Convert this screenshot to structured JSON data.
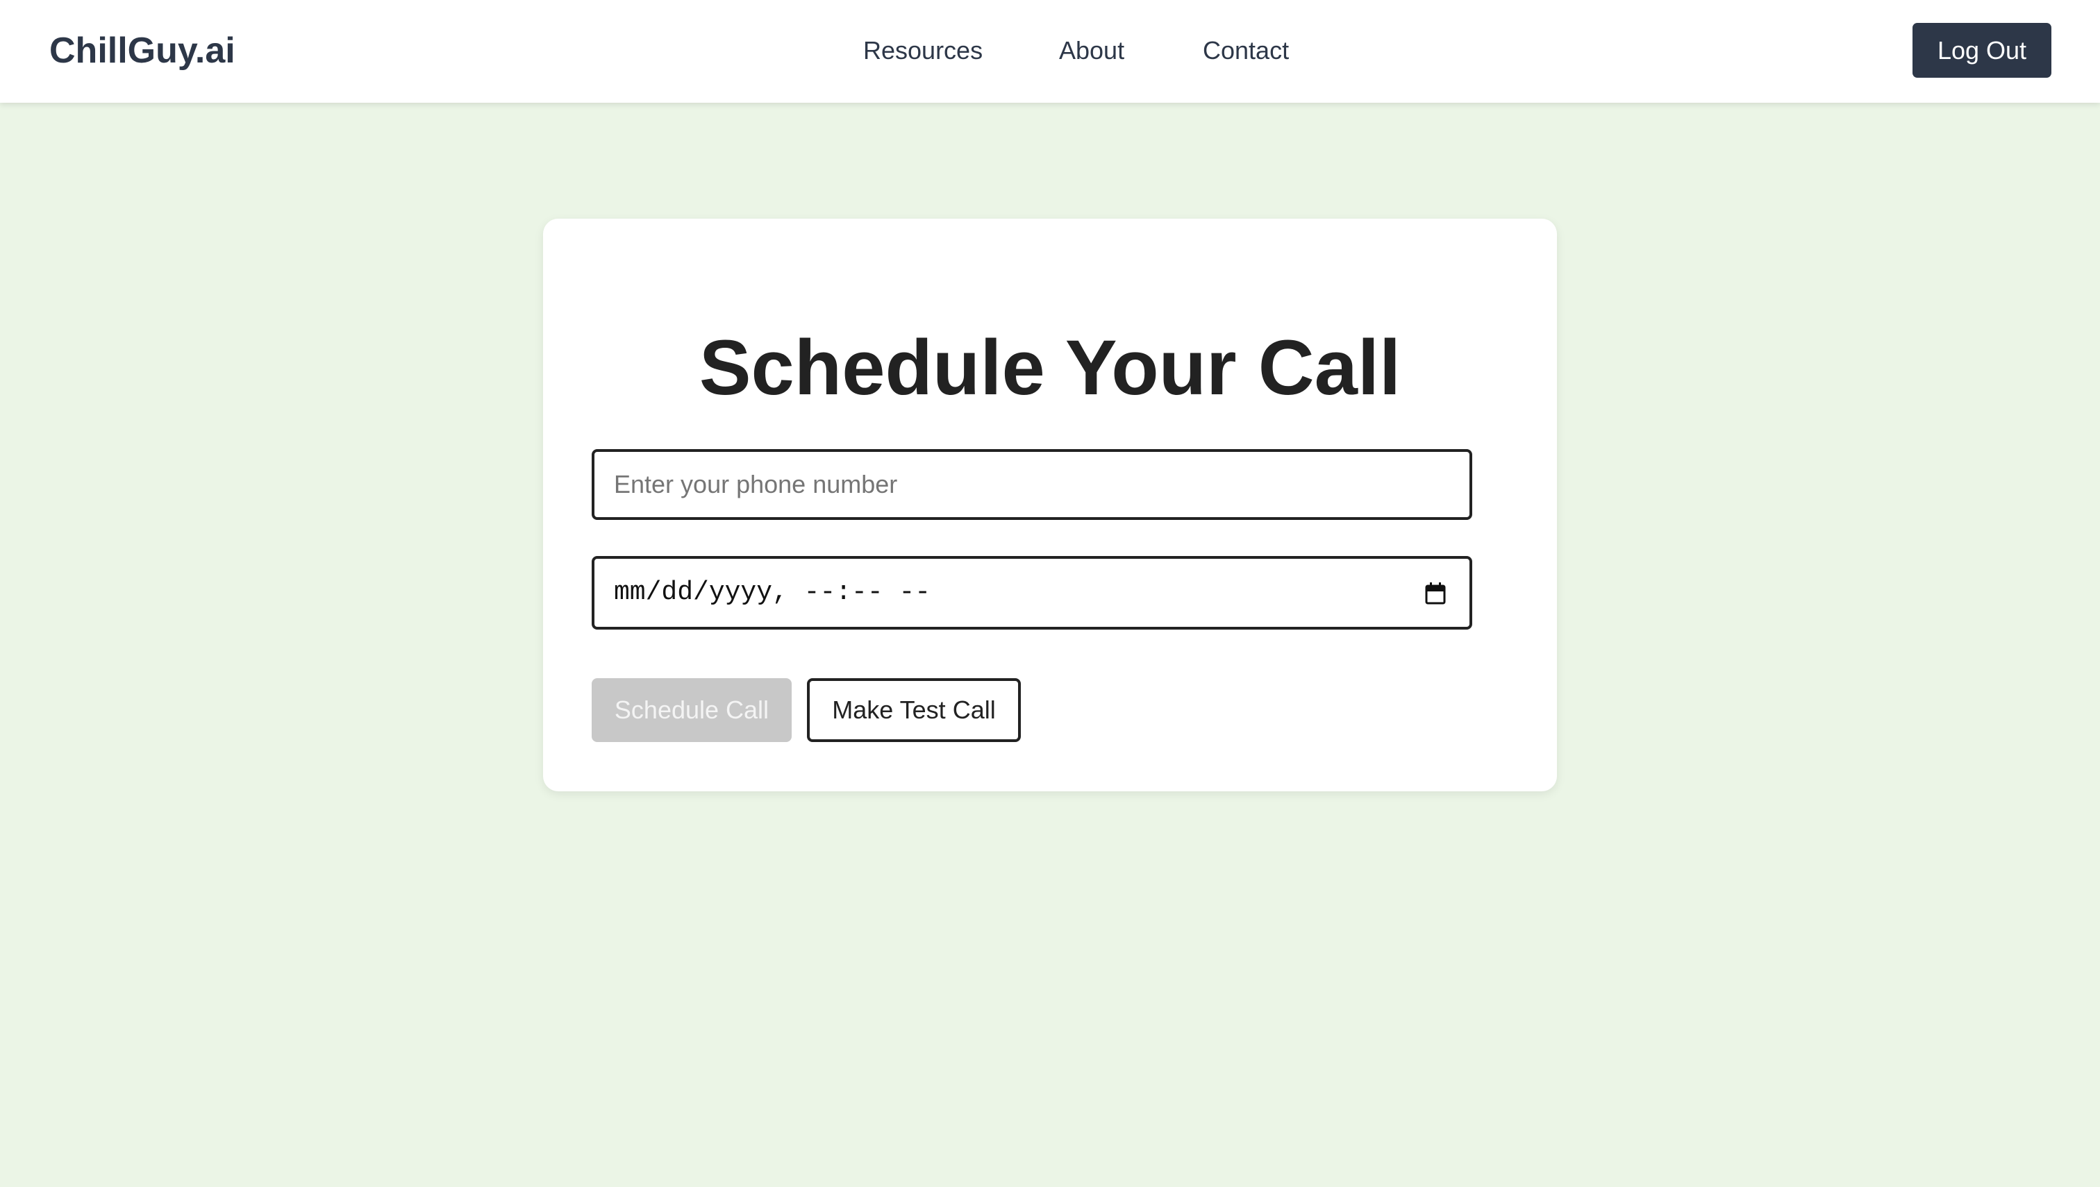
{
  "header": {
    "logo": "ChillGuy.ai",
    "nav": {
      "resources": "Resources",
      "about": "About",
      "contact": "Contact"
    },
    "logout_label": "Log Out"
  },
  "main": {
    "title": "Schedule Your Call",
    "phone_input": {
      "placeholder": "Enter your phone number",
      "value": ""
    },
    "datetime_input": {
      "display": "mm/dd/yyyy, --:-- --",
      "icon": "calendar-icon"
    },
    "schedule_button": {
      "label": "Schedule Call",
      "disabled": true
    },
    "test_call_button": {
      "label": "Make Test Call"
    }
  },
  "colors": {
    "page_background": "#ebf5e6",
    "navbar_background": "#ffffff",
    "brand_dark": "#2d3748",
    "disabled_button": "#c8c8c8",
    "border": "#222222"
  }
}
